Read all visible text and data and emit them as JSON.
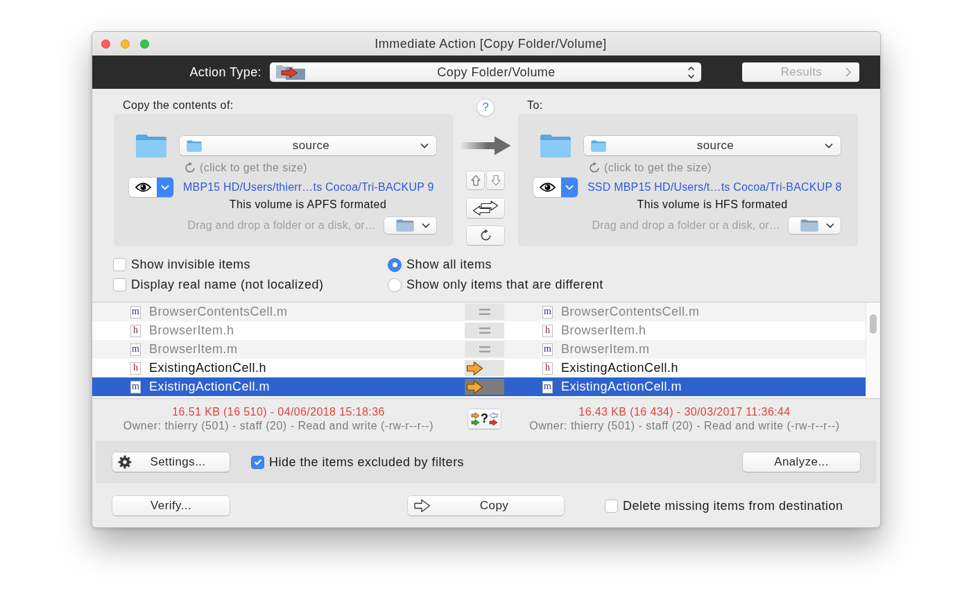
{
  "window": {
    "title": "Immediate Action [Copy Folder/Volume]"
  },
  "toolbar": {
    "label": "Action Type:",
    "action_type": "Copy Folder/Volume",
    "results_button": {
      "label": "Results",
      "disabled": true
    }
  },
  "help_button": "?",
  "panels": [
    {
      "heading": "Copy the contents of:",
      "folder": "source",
      "size_hint": "(click to get the size)",
      "path": "MBP15 HD/Users/thierr…ts Cocoa/Tri-BACKUP 9",
      "format_note": "This volume is APFS formated",
      "drop_hint": "Drag and drop a folder or a disk, or…"
    },
    {
      "heading": "To:",
      "folder": "source",
      "size_hint": "(click to get the size)",
      "path": "SSD MBP15 HD/Users/t…ts Cocoa/Tri-BACKUP 8",
      "format_note": "This volume is HFS formated",
      "drop_hint": "Drag and drop a folder or a disk, or…"
    }
  ],
  "options": {
    "checkboxes": [
      {
        "label": "Show invisible items",
        "checked": false
      },
      {
        "label": "Display real name (not localized)",
        "checked": false
      }
    ],
    "radios": [
      {
        "label": "Show all items",
        "selected": true
      },
      {
        "label": "Show only items that are different",
        "selected": false
      }
    ]
  },
  "file_list": {
    "rows": [
      {
        "kind": "same",
        "selected": false,
        "source": {
          "type": "m",
          "name": "BrowserContentsCell.m"
        },
        "destination": {
          "type": "m",
          "name": "BrowserContentsCell.m"
        }
      },
      {
        "kind": "same",
        "selected": false,
        "source": {
          "type": "h",
          "name": "BrowserItem.h"
        },
        "destination": {
          "type": "h",
          "name": "BrowserItem.h"
        }
      },
      {
        "kind": "same",
        "selected": false,
        "source": {
          "type": "m",
          "name": "BrowserItem.m"
        },
        "destination": {
          "type": "m",
          "name": "BrowserItem.m"
        }
      },
      {
        "kind": "copy",
        "selected": false,
        "source": {
          "type": "h",
          "name": "ExistingActionCell.h"
        },
        "destination": {
          "type": "h",
          "name": "ExistingActionCell.h"
        }
      },
      {
        "kind": "copy",
        "selected": true,
        "source": {
          "type": "m",
          "name": "ExistingActionCell.m"
        },
        "destination": {
          "type": "m",
          "name": "ExistingActionCell.m"
        }
      }
    ]
  },
  "details": [
    {
      "size_date": "16.51 KB (16 510) - 04/06/2018 15:18:36",
      "owner": "Owner: thierry (501) - staff (20) - Read and write (-rw-r--r--)"
    },
    {
      "size_date": "16.43 KB (16 434) - 30/03/2017 11:36:44",
      "owner": "Owner: thierry (501) - staff (20) - Read and write (-rw-r--r--)"
    }
  ],
  "compare_button": "?",
  "filter_bar": {
    "settings_button": "Settings...",
    "hide_excluded": {
      "label": "Hide the items excluded by filters",
      "checked": true
    },
    "analyze_button": "Analyze..."
  },
  "footer": {
    "verify_button": "Verify...",
    "copy_button": "Copy",
    "delete_missing": {
      "label": "Delete missing items from destination",
      "checked": false
    }
  }
}
